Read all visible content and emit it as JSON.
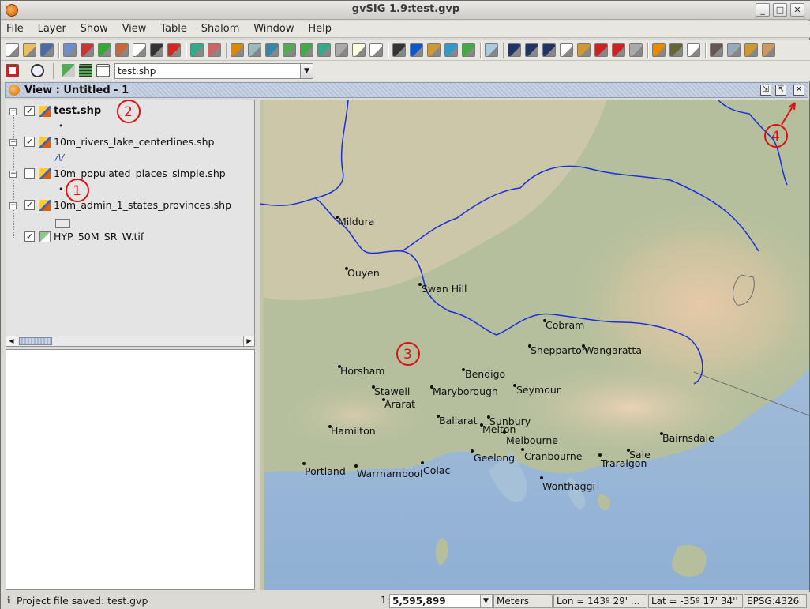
{
  "window": {
    "title": "gvSIG 1.9:test.gvp",
    "minimize": "_",
    "maximize": "□",
    "close": "✕"
  },
  "menu": [
    "File",
    "Layer",
    "Show",
    "View",
    "Table",
    "Shalom",
    "Window",
    "Help"
  ],
  "toolbar2": {
    "layer_select": "test.shp",
    "dropdown_arrow": "▼"
  },
  "view": {
    "title": "View : Untitled - 1",
    "icon": "view-icon",
    "buttons": [
      "minimize-view-icon",
      "restore-view-icon",
      "close-view-icon"
    ]
  },
  "toc": {
    "layers": [
      {
        "name": "test.shp",
        "checked": true,
        "bold": true,
        "legend": "•"
      },
      {
        "name": "10m_rivers_lake_centerlines.shp",
        "checked": true,
        "legend": "/\\/"
      },
      {
        "name": "10m_populated_places_simple.shp",
        "checked": false,
        "legend": "•"
      },
      {
        "name": "10m_admin_1_states_provinces.shp",
        "checked": true,
        "legend": ""
      },
      {
        "name": "HYP_50M_SR_W.tif",
        "checked": true,
        "legend": ""
      }
    ],
    "check_mark": "✓",
    "expand_mark": "−"
  },
  "map": {
    "cities": [
      {
        "name": "Mildura"
      },
      {
        "name": "Ouyen"
      },
      {
        "name": "Swan Hill"
      },
      {
        "name": "Cobram"
      },
      {
        "name": "Shepparton"
      },
      {
        "name": "Wangaratta"
      },
      {
        "name": "Horsham"
      },
      {
        "name": "Bendigo"
      },
      {
        "name": "Stawell"
      },
      {
        "name": "Maryborough"
      },
      {
        "name": "Seymour"
      },
      {
        "name": "Ararat"
      },
      {
        "name": "Ballarat"
      },
      {
        "name": "Sunbury"
      },
      {
        "name": "Hamilton"
      },
      {
        "name": "Melton"
      },
      {
        "name": "Melbourne"
      },
      {
        "name": "Bairnsdale"
      },
      {
        "name": "Geelong"
      },
      {
        "name": "Cranbourne"
      },
      {
        "name": "Sale"
      },
      {
        "name": "Traralgon"
      },
      {
        "name": "Portland"
      },
      {
        "name": "Warrnambool"
      },
      {
        "name": "Colac"
      },
      {
        "name": "Wonthaggi"
      }
    ],
    "annotations": [
      "1",
      "2",
      "3",
      "4"
    ]
  },
  "status": {
    "message": "Project file saved: test.gvp",
    "scale_prefix": "1:",
    "scale": "5,595,899",
    "units": "Meters",
    "lon": "Lon = 143º 29' ...",
    "lat": "Lat = -35º 17' 34''",
    "epsg": "EPSG:4326"
  },
  "colors": {
    "river": "#1a2fd8",
    "annotation": "#dd1111",
    "view_header": "#c6d0e1"
  }
}
